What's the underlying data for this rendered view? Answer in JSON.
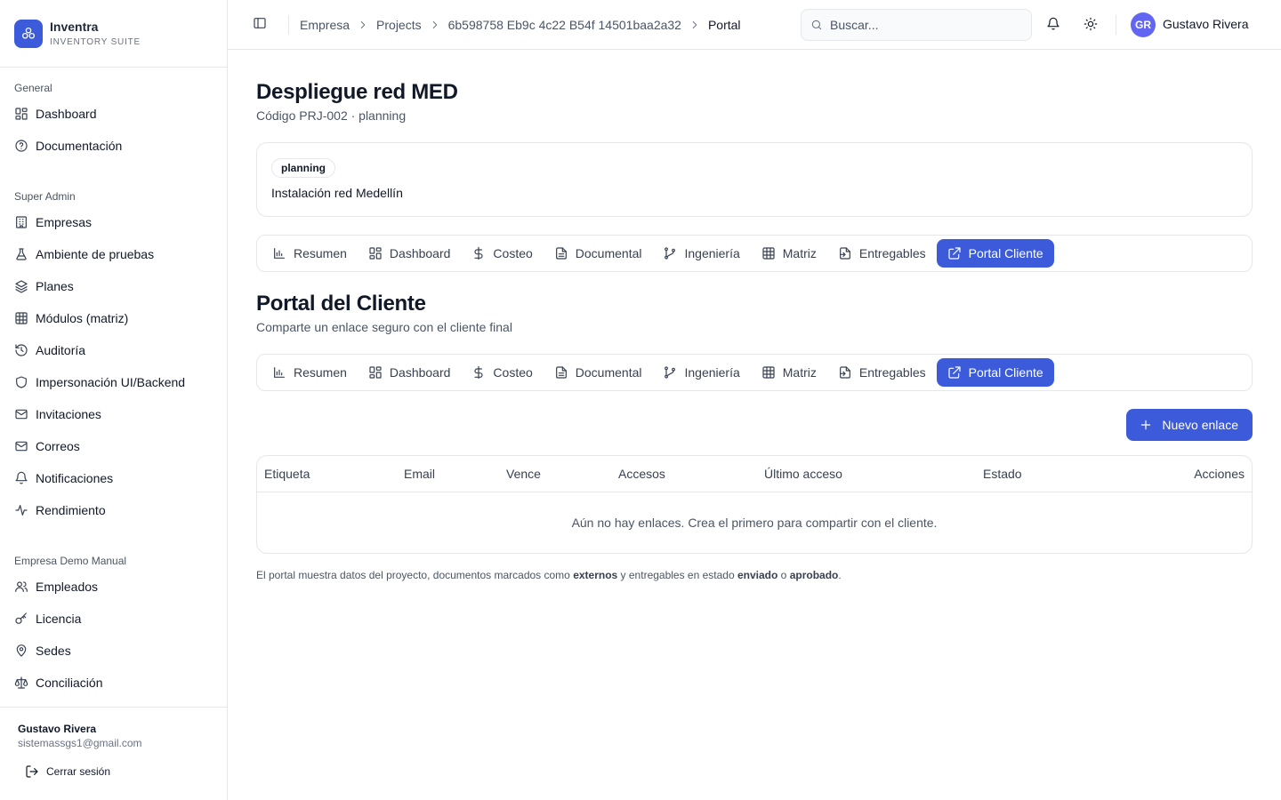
{
  "brand": {
    "name": "Inventra",
    "subtitle": "INVENTORY SUITE"
  },
  "sidebar": {
    "groups": [
      {
        "label": "General",
        "items": [
          {
            "label": "Dashboard",
            "icon": "layout-grid-icon"
          },
          {
            "label": "Documentación",
            "icon": "help-circle-icon"
          }
        ]
      },
      {
        "label": "Super Admin",
        "items": [
          {
            "label": "Empresas",
            "icon": "building-icon"
          },
          {
            "label": "Ambiente de pruebas",
            "icon": "flask-icon"
          },
          {
            "label": "Planes",
            "icon": "layers-icon"
          },
          {
            "label": "Módulos (matriz)",
            "icon": "table-icon"
          },
          {
            "label": "Auditoría",
            "icon": "history-icon"
          },
          {
            "label": "Impersonación UI/Backend",
            "icon": "shield-icon"
          },
          {
            "label": "Invitaciones",
            "icon": "mail-icon"
          },
          {
            "label": "Correos",
            "icon": "mail-icon"
          },
          {
            "label": "Notificaciones",
            "icon": "bell-icon"
          },
          {
            "label": "Rendimiento",
            "icon": "activity-icon"
          }
        ]
      },
      {
        "label": "Empresa Demo Manual",
        "items": [
          {
            "label": "Empleados",
            "icon": "users-icon"
          },
          {
            "label": "Licencia",
            "icon": "key-icon"
          },
          {
            "label": "Sedes",
            "icon": "map-pin-icon"
          },
          {
            "label": "Conciliación",
            "icon": "scale-icon"
          }
        ]
      }
    ],
    "user": {
      "name": "Gustavo Rivera",
      "email": "sistemassgs1@gmail.com",
      "logout_label": "Cerrar sesión"
    }
  },
  "header": {
    "breadcrumbs": [
      "Empresa",
      "Projects",
      "6b598758 Eb9c 4c22 B54f 14501baa2a32",
      "Portal"
    ],
    "search_placeholder": "Buscar...",
    "avatar_initials": "GR",
    "user_name": "Gustavo Rivera"
  },
  "project": {
    "title": "Despliegue red MED",
    "subtitle": "Código PRJ-002 · planning",
    "badge": "planning",
    "description": "Instalación red Medellín"
  },
  "tabs": [
    {
      "label": "Resumen",
      "icon": "bar-chart-icon",
      "active": false
    },
    {
      "label": "Dashboard",
      "icon": "layout-grid-icon",
      "active": false
    },
    {
      "label": "Costeo",
      "icon": "dollar-icon",
      "active": false
    },
    {
      "label": "Documental",
      "icon": "file-text-icon",
      "active": false
    },
    {
      "label": "Ingeniería",
      "icon": "git-branch-icon",
      "active": false
    },
    {
      "label": "Matriz",
      "icon": "table-icon",
      "active": false
    },
    {
      "label": "Entregables",
      "icon": "file-check-icon",
      "active": false
    },
    {
      "label": "Portal Cliente",
      "icon": "external-link-icon",
      "active": true
    }
  ],
  "portal": {
    "title": "Portal del Cliente",
    "subtitle": "Comparte un enlace seguro con el cliente final",
    "new_link_label": "Nuevo enlace",
    "columns": [
      "Etiqueta",
      "Email",
      "Vence",
      "Accesos",
      "Último acceso",
      "Estado",
      "Acciones"
    ],
    "empty_message": "Aún no hay enlaces. Crea el primero para compartir con el cliente.",
    "footnote": {
      "part1": "El portal muestra datos del proyecto, documentos marcados como ",
      "bold1": "externos",
      "part2": " y entregables en estado ",
      "bold2": "enviado",
      "part3": " o ",
      "bold3": "aprobado",
      "part4": "."
    }
  },
  "colors": {
    "accent": "#3b5bdb",
    "avatar": "#6366f1",
    "border": "#e5e7eb"
  }
}
